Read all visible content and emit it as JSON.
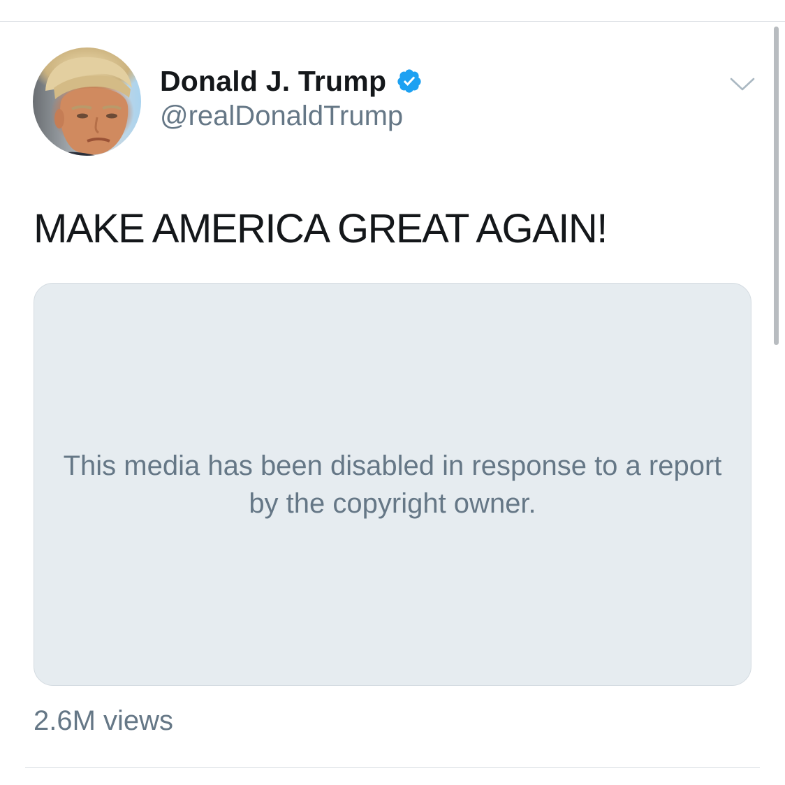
{
  "tweet": {
    "author_name": "Donald J. Trump",
    "author_handle": "@realDonaldTrump",
    "verified": true,
    "verified_icon": "verified-badge-icon",
    "menu_icon": "chevron-down-icon",
    "text": "MAKE AMERICA GREAT AGAIN!",
    "media": {
      "message": "This media has been disabled in response to a report by the copyright owner."
    },
    "views": "2.6M views"
  },
  "colors": {
    "primary_text": "#14171a",
    "secondary_text": "#657786",
    "verified_blue": "#1da1f2",
    "media_background": "#e6ecf0",
    "divider": "#d6dbe0"
  }
}
